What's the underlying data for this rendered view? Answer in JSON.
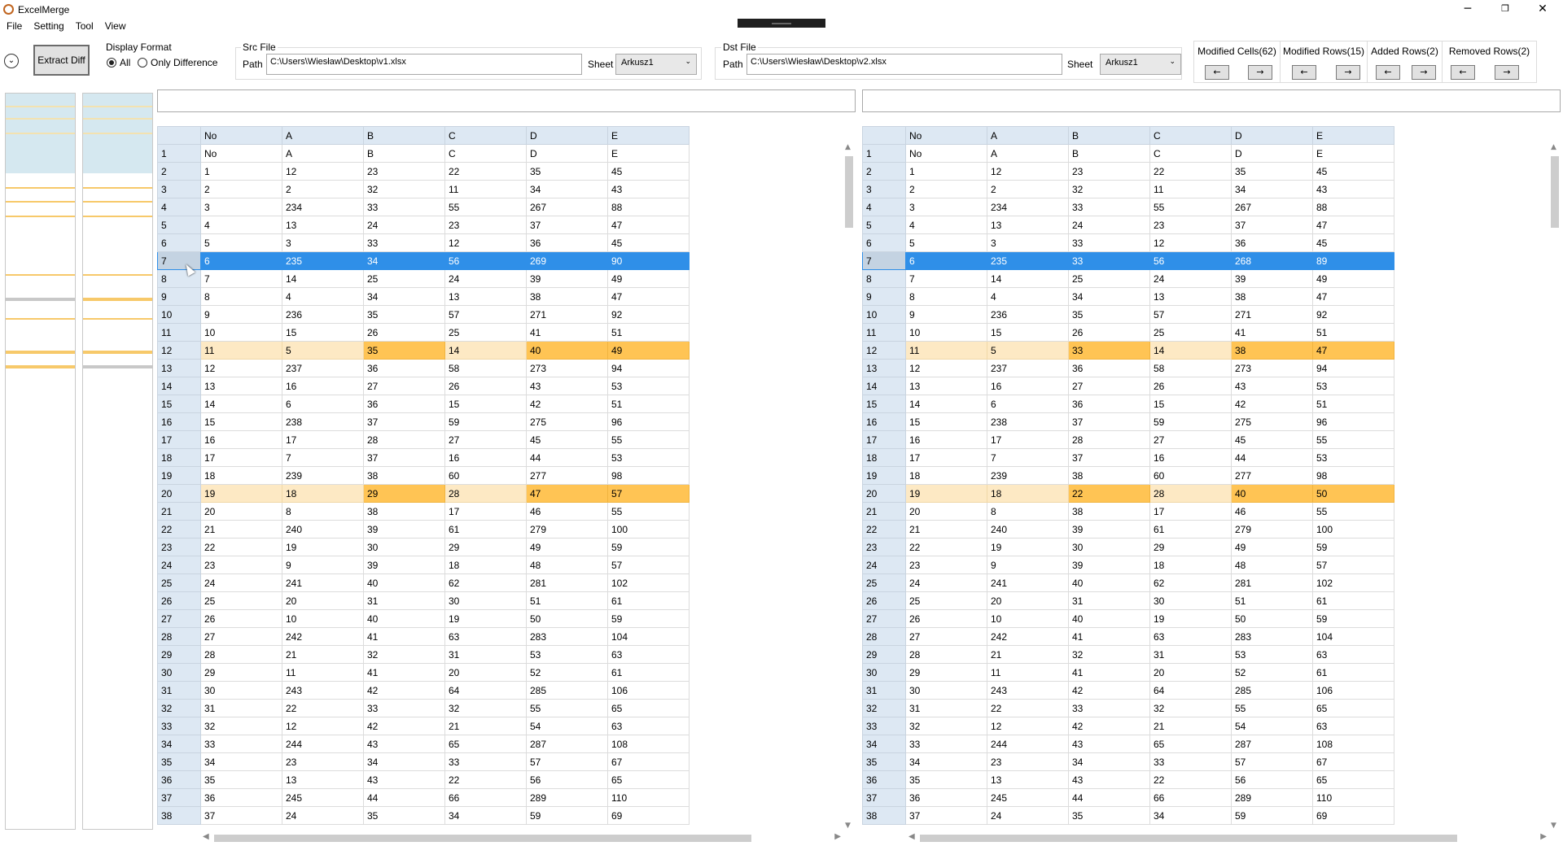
{
  "window": {
    "title": "ExcelMerge",
    "minimize": "─",
    "maximize": "❐",
    "close": "✕"
  },
  "menu": [
    "File",
    "Setting",
    "Tool",
    "View"
  ],
  "toolbar": {
    "collapse_icon": "chevron-down-icon",
    "extract_label": "Extract Diff",
    "display_format": {
      "label": "Display Format",
      "options": [
        "All",
        "Only Difference"
      ],
      "selected": "All"
    },
    "src": {
      "label": "Src File",
      "path_label": "Path",
      "path": "C:\\Users\\Wiesław\\Desktop\\v1.xlsx",
      "sheet_label": "Sheet",
      "sheet": "Arkusz1"
    },
    "dst": {
      "label": "Dst File",
      "path_label": "Path",
      "path": "C:\\Users\\Wiesław\\Desktop\\v2.xlsx",
      "sheet_label": "Sheet",
      "sheet": "Arkusz1"
    },
    "nav": [
      {
        "label": "Modified Cells(62)",
        "prev": "←",
        "next": "→"
      },
      {
        "label": "Modified Rows(15)",
        "prev": "←",
        "next": "→"
      },
      {
        "label": "Added Rows(2)",
        "prev": "←",
        "next": "→"
      },
      {
        "label": "Removed Rows(2)",
        "prev": "←",
        "next": "→"
      }
    ]
  },
  "colors": {
    "selection": "#2f8fe8",
    "modified_row": "#fde9c4",
    "modified_cell": "#ffc454",
    "header": "#dde8f3",
    "removed": "#c8c8c8"
  },
  "grid": {
    "column_headers": [
      "No",
      "A",
      "B",
      "C",
      "D",
      "E"
    ],
    "selected_row": 7,
    "left": [
      [
        "No",
        "A",
        "B",
        "C",
        "D",
        "E"
      ],
      [
        "1",
        "12",
        "23",
        "22",
        "35",
        "45"
      ],
      [
        "2",
        "2",
        "32",
        "11",
        "34",
        "43"
      ],
      [
        "3",
        "234",
        "33",
        "55",
        "267",
        "88"
      ],
      [
        "4",
        "13",
        "24",
        "23",
        "37",
        "47"
      ],
      [
        "5",
        "3",
        "33",
        "12",
        "36",
        "45"
      ],
      [
        "6",
        "235",
        "34",
        "56",
        "269",
        "90"
      ],
      [
        "7",
        "14",
        "25",
        "24",
        "39",
        "49"
      ],
      [
        "8",
        "4",
        "34",
        "13",
        "38",
        "47"
      ],
      [
        "9",
        "236",
        "35",
        "57",
        "271",
        "92"
      ],
      [
        "10",
        "15",
        "26",
        "25",
        "41",
        "51"
      ],
      [
        "11",
        "5",
        "35",
        "14",
        "40",
        "49"
      ],
      [
        "12",
        "237",
        "36",
        "58",
        "273",
        "94"
      ],
      [
        "13",
        "16",
        "27",
        "26",
        "43",
        "53"
      ],
      [
        "14",
        "6",
        "36",
        "15",
        "42",
        "51"
      ],
      [
        "15",
        "238",
        "37",
        "59",
        "275",
        "96"
      ],
      [
        "16",
        "17",
        "28",
        "27",
        "45",
        "55"
      ],
      [
        "17",
        "7",
        "37",
        "16",
        "44",
        "53"
      ],
      [
        "18",
        "239",
        "38",
        "60",
        "277",
        "98"
      ],
      [
        "19",
        "18",
        "29",
        "28",
        "47",
        "57"
      ],
      [
        "20",
        "8",
        "38",
        "17",
        "46",
        "55"
      ],
      [
        "21",
        "240",
        "39",
        "61",
        "279",
        "100"
      ],
      [
        "22",
        "19",
        "30",
        "29",
        "49",
        "59"
      ],
      [
        "23",
        "9",
        "39",
        "18",
        "48",
        "57"
      ],
      [
        "24",
        "241",
        "40",
        "62",
        "281",
        "102"
      ],
      [
        "25",
        "20",
        "31",
        "30",
        "51",
        "61"
      ],
      [
        "26",
        "10",
        "40",
        "19",
        "50",
        "59"
      ],
      [
        "27",
        "242",
        "41",
        "63",
        "283",
        "104"
      ],
      [
        "28",
        "21",
        "32",
        "31",
        "53",
        "63"
      ],
      [
        "29",
        "11",
        "41",
        "20",
        "52",
        "61"
      ],
      [
        "30",
        "243",
        "42",
        "64",
        "285",
        "106"
      ],
      [
        "31",
        "22",
        "33",
        "32",
        "55",
        "65"
      ],
      [
        "32",
        "12",
        "42",
        "21",
        "54",
        "63"
      ],
      [
        "33",
        "244",
        "43",
        "65",
        "287",
        "108"
      ],
      [
        "34",
        "23",
        "34",
        "33",
        "57",
        "67"
      ],
      [
        "35",
        "13",
        "43",
        "22",
        "56",
        "65"
      ],
      [
        "36",
        "245",
        "44",
        "66",
        "289",
        "110"
      ],
      [
        "37",
        "24",
        "35",
        "34",
        "59",
        "69"
      ]
    ],
    "right": [
      [
        "No",
        "A",
        "B",
        "C",
        "D",
        "E"
      ],
      [
        "1",
        "12",
        "23",
        "22",
        "35",
        "45"
      ],
      [
        "2",
        "2",
        "32",
        "11",
        "34",
        "43"
      ],
      [
        "3",
        "234",
        "33",
        "55",
        "267",
        "88"
      ],
      [
        "4",
        "13",
        "24",
        "23",
        "37",
        "47"
      ],
      [
        "5",
        "3",
        "33",
        "12",
        "36",
        "45"
      ],
      [
        "6",
        "235",
        "33",
        "56",
        "268",
        "89"
      ],
      [
        "7",
        "14",
        "25",
        "24",
        "39",
        "49"
      ],
      [
        "8",
        "4",
        "34",
        "13",
        "38",
        "47"
      ],
      [
        "9",
        "236",
        "35",
        "57",
        "271",
        "92"
      ],
      [
        "10",
        "15",
        "26",
        "25",
        "41",
        "51"
      ],
      [
        "11",
        "5",
        "33",
        "14",
        "38",
        "47"
      ],
      [
        "12",
        "237",
        "36",
        "58",
        "273",
        "94"
      ],
      [
        "13",
        "16",
        "27",
        "26",
        "43",
        "53"
      ],
      [
        "14",
        "6",
        "36",
        "15",
        "42",
        "51"
      ],
      [
        "15",
        "238",
        "37",
        "59",
        "275",
        "96"
      ],
      [
        "16",
        "17",
        "28",
        "27",
        "45",
        "55"
      ],
      [
        "17",
        "7",
        "37",
        "16",
        "44",
        "53"
      ],
      [
        "18",
        "239",
        "38",
        "60",
        "277",
        "98"
      ],
      [
        "19",
        "18",
        "22",
        "28",
        "40",
        "50"
      ],
      [
        "20",
        "8",
        "38",
        "17",
        "46",
        "55"
      ],
      [
        "21",
        "240",
        "39",
        "61",
        "279",
        "100"
      ],
      [
        "22",
        "19",
        "30",
        "29",
        "49",
        "59"
      ],
      [
        "23",
        "9",
        "39",
        "18",
        "48",
        "57"
      ],
      [
        "24",
        "241",
        "40",
        "62",
        "281",
        "102"
      ],
      [
        "25",
        "20",
        "31",
        "30",
        "51",
        "61"
      ],
      [
        "26",
        "10",
        "40",
        "19",
        "50",
        "59"
      ],
      [
        "27",
        "242",
        "41",
        "63",
        "283",
        "104"
      ],
      [
        "28",
        "21",
        "32",
        "31",
        "53",
        "63"
      ],
      [
        "29",
        "11",
        "41",
        "20",
        "52",
        "61"
      ],
      [
        "30",
        "243",
        "42",
        "64",
        "285",
        "106"
      ],
      [
        "31",
        "22",
        "33",
        "32",
        "55",
        "65"
      ],
      [
        "32",
        "12",
        "42",
        "21",
        "54",
        "63"
      ],
      [
        "33",
        "244",
        "43",
        "65",
        "287",
        "108"
      ],
      [
        "34",
        "23",
        "34",
        "33",
        "57",
        "67"
      ],
      [
        "35",
        "13",
        "43",
        "22",
        "56",
        "65"
      ],
      [
        "36",
        "245",
        "44",
        "66",
        "289",
        "110"
      ],
      [
        "37",
        "24",
        "35",
        "34",
        "59",
        "69"
      ]
    ],
    "modified_rows": [
      {
        "row": 12,
        "strong_cols": [
          2,
          4,
          5
        ]
      },
      {
        "row": 20,
        "strong_cols": [
          2,
          4,
          5
        ]
      }
    ]
  }
}
